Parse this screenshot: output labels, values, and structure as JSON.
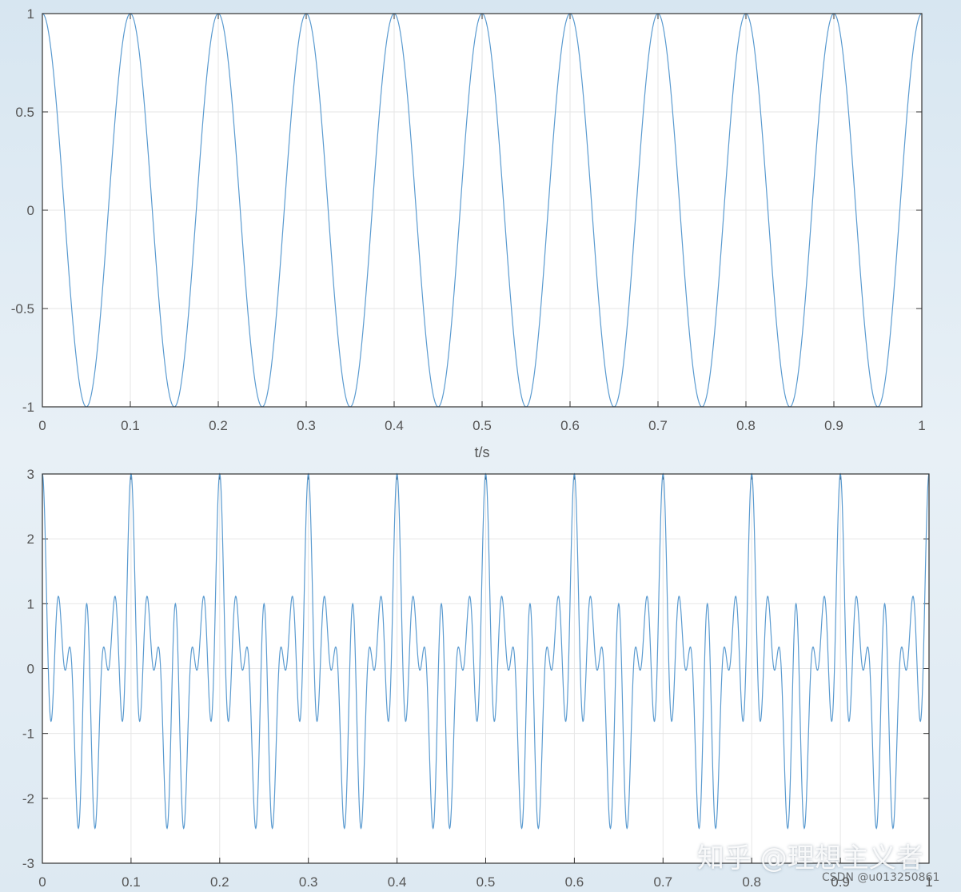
{
  "chart_data": [
    {
      "type": "line",
      "xlabel": "t/s",
      "xlim": [
        0,
        1
      ],
      "ylim": [
        -1,
        1
      ],
      "xticks": [
        "0",
        "0.1",
        "0.2",
        "0.3",
        "0.4",
        "0.5",
        "0.6",
        "0.7",
        "0.8",
        "0.9",
        "1"
      ],
      "yticks": [
        "1",
        "0.5",
        "0",
        "-0.5",
        "-1"
      ],
      "grid": true,
      "line_color": "#5b9bd0",
      "series": [
        {
          "expression": "cos(2*pi*10*t)",
          "frequency_hz": 10,
          "amplitude": 1
        }
      ]
    },
    {
      "type": "line",
      "xlabel": "",
      "xlim": [
        0,
        1
      ],
      "ylim": [
        -3,
        3
      ],
      "xticks": [
        "0",
        "0.1",
        "0.2",
        "0.3",
        "0.4",
        "0.5",
        "0.6",
        "0.7",
        "0.8",
        "0.9",
        "1"
      ],
      "yticks": [
        "3",
        "2",
        "1",
        "0",
        "-1",
        "-2",
        "-3"
      ],
      "grid": true,
      "line_color": "#5b9bd0",
      "series": [
        {
          "expression": "cos(2*pi*10*t)+cos(2*pi*40*t)+cos(2*pi*60*t)",
          "components_hz": [
            10,
            40,
            60
          ],
          "amplitude": 1
        }
      ]
    }
  ],
  "watermarks": {
    "zhihu": "知乎 @理想主义者",
    "csdn": "CSDN @u013250861"
  }
}
